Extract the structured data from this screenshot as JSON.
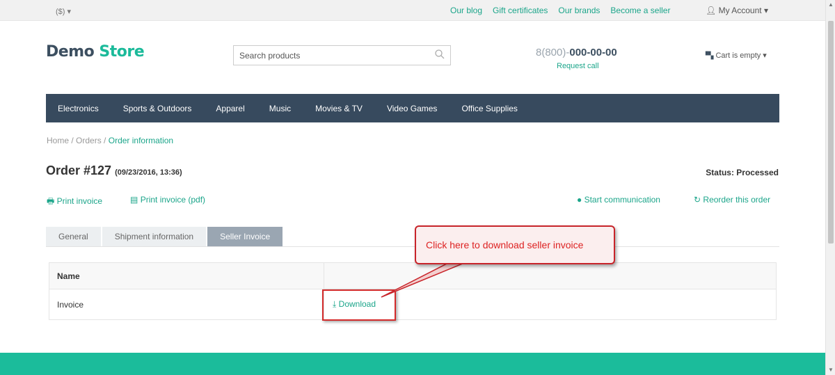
{
  "topbar": {
    "currency": "($) ▾",
    "links": [
      "Our blog",
      "Gift certificates",
      "Our brands",
      "Become a seller"
    ],
    "account": "My Account ▾"
  },
  "header": {
    "logo_part1": "Demo",
    "logo_part2": "Store",
    "search_placeholder": "Search products",
    "phone_prefix": "8(800)-",
    "phone_number": "000-00-00",
    "request_call": "Request call",
    "cart": "Cart is empty ▾"
  },
  "menu": [
    "Electronics",
    "Sports & Outdoors",
    "Apparel",
    "Music",
    "Movies & TV",
    "Video Games",
    "Office Supplies"
  ],
  "breadcrumb": {
    "home": "Home",
    "orders": "Orders",
    "current": "Order information",
    "sep": " / "
  },
  "order": {
    "title": "Order #127",
    "date": "(09/23/2016, 13:36)",
    "status": "Status: Processed"
  },
  "actions": {
    "print_invoice": "Print invoice",
    "print_invoice_pdf": "Print invoice (pdf)",
    "start_communication": "Start communication",
    "reorder": "Reorder this order"
  },
  "tabs": [
    "General",
    "Shipment information",
    "Seller Invoice"
  ],
  "table": {
    "header_name": "Name",
    "row_name": "Invoice",
    "row_action": "Download"
  },
  "annotation": {
    "callout": "Click here to download seller invoice"
  },
  "colors": {
    "accent": "#1ba58a",
    "nav": "#374a5e",
    "footer": "#1bbc9b",
    "callout_border": "#c8242a"
  }
}
